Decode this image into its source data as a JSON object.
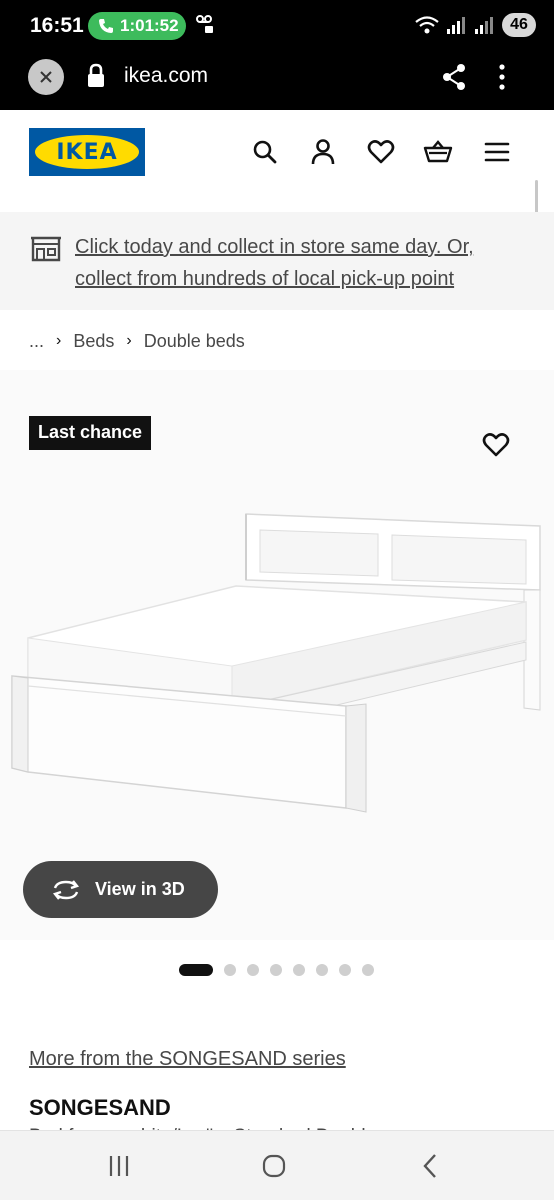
{
  "status_bar": {
    "time": "16:51",
    "call_duration": "1:01:52",
    "battery": "46"
  },
  "browser": {
    "url": "ikea.com"
  },
  "header": {
    "logo_text": "IKEA",
    "brand_colors": {
      "blue": "#0058a3",
      "yellow": "#ffdb00"
    },
    "icons": [
      "search-icon",
      "account-icon",
      "heart-icon",
      "basket-icon",
      "menu-icon"
    ]
  },
  "banner": {
    "text": "Click today and collect in store same day. Or, collect from hundreds of local pick-up point",
    "icon": "store-icon"
  },
  "breadcrumb": {
    "ellipsis": "...",
    "items": [
      "Beds",
      "Double beds"
    ]
  },
  "gallery": {
    "badge": "Last chance",
    "view_3d_label": "View in 3D",
    "slide_count": 8,
    "active_slide": 1
  },
  "product": {
    "series_link": "More from the SONGESAND series",
    "name": "SONGESAND",
    "description_partial": "Bed frame, white/Luröy, Standard Double"
  },
  "nav_bar": {
    "icons": [
      "recent-apps-icon",
      "home-icon",
      "back-icon"
    ]
  }
}
